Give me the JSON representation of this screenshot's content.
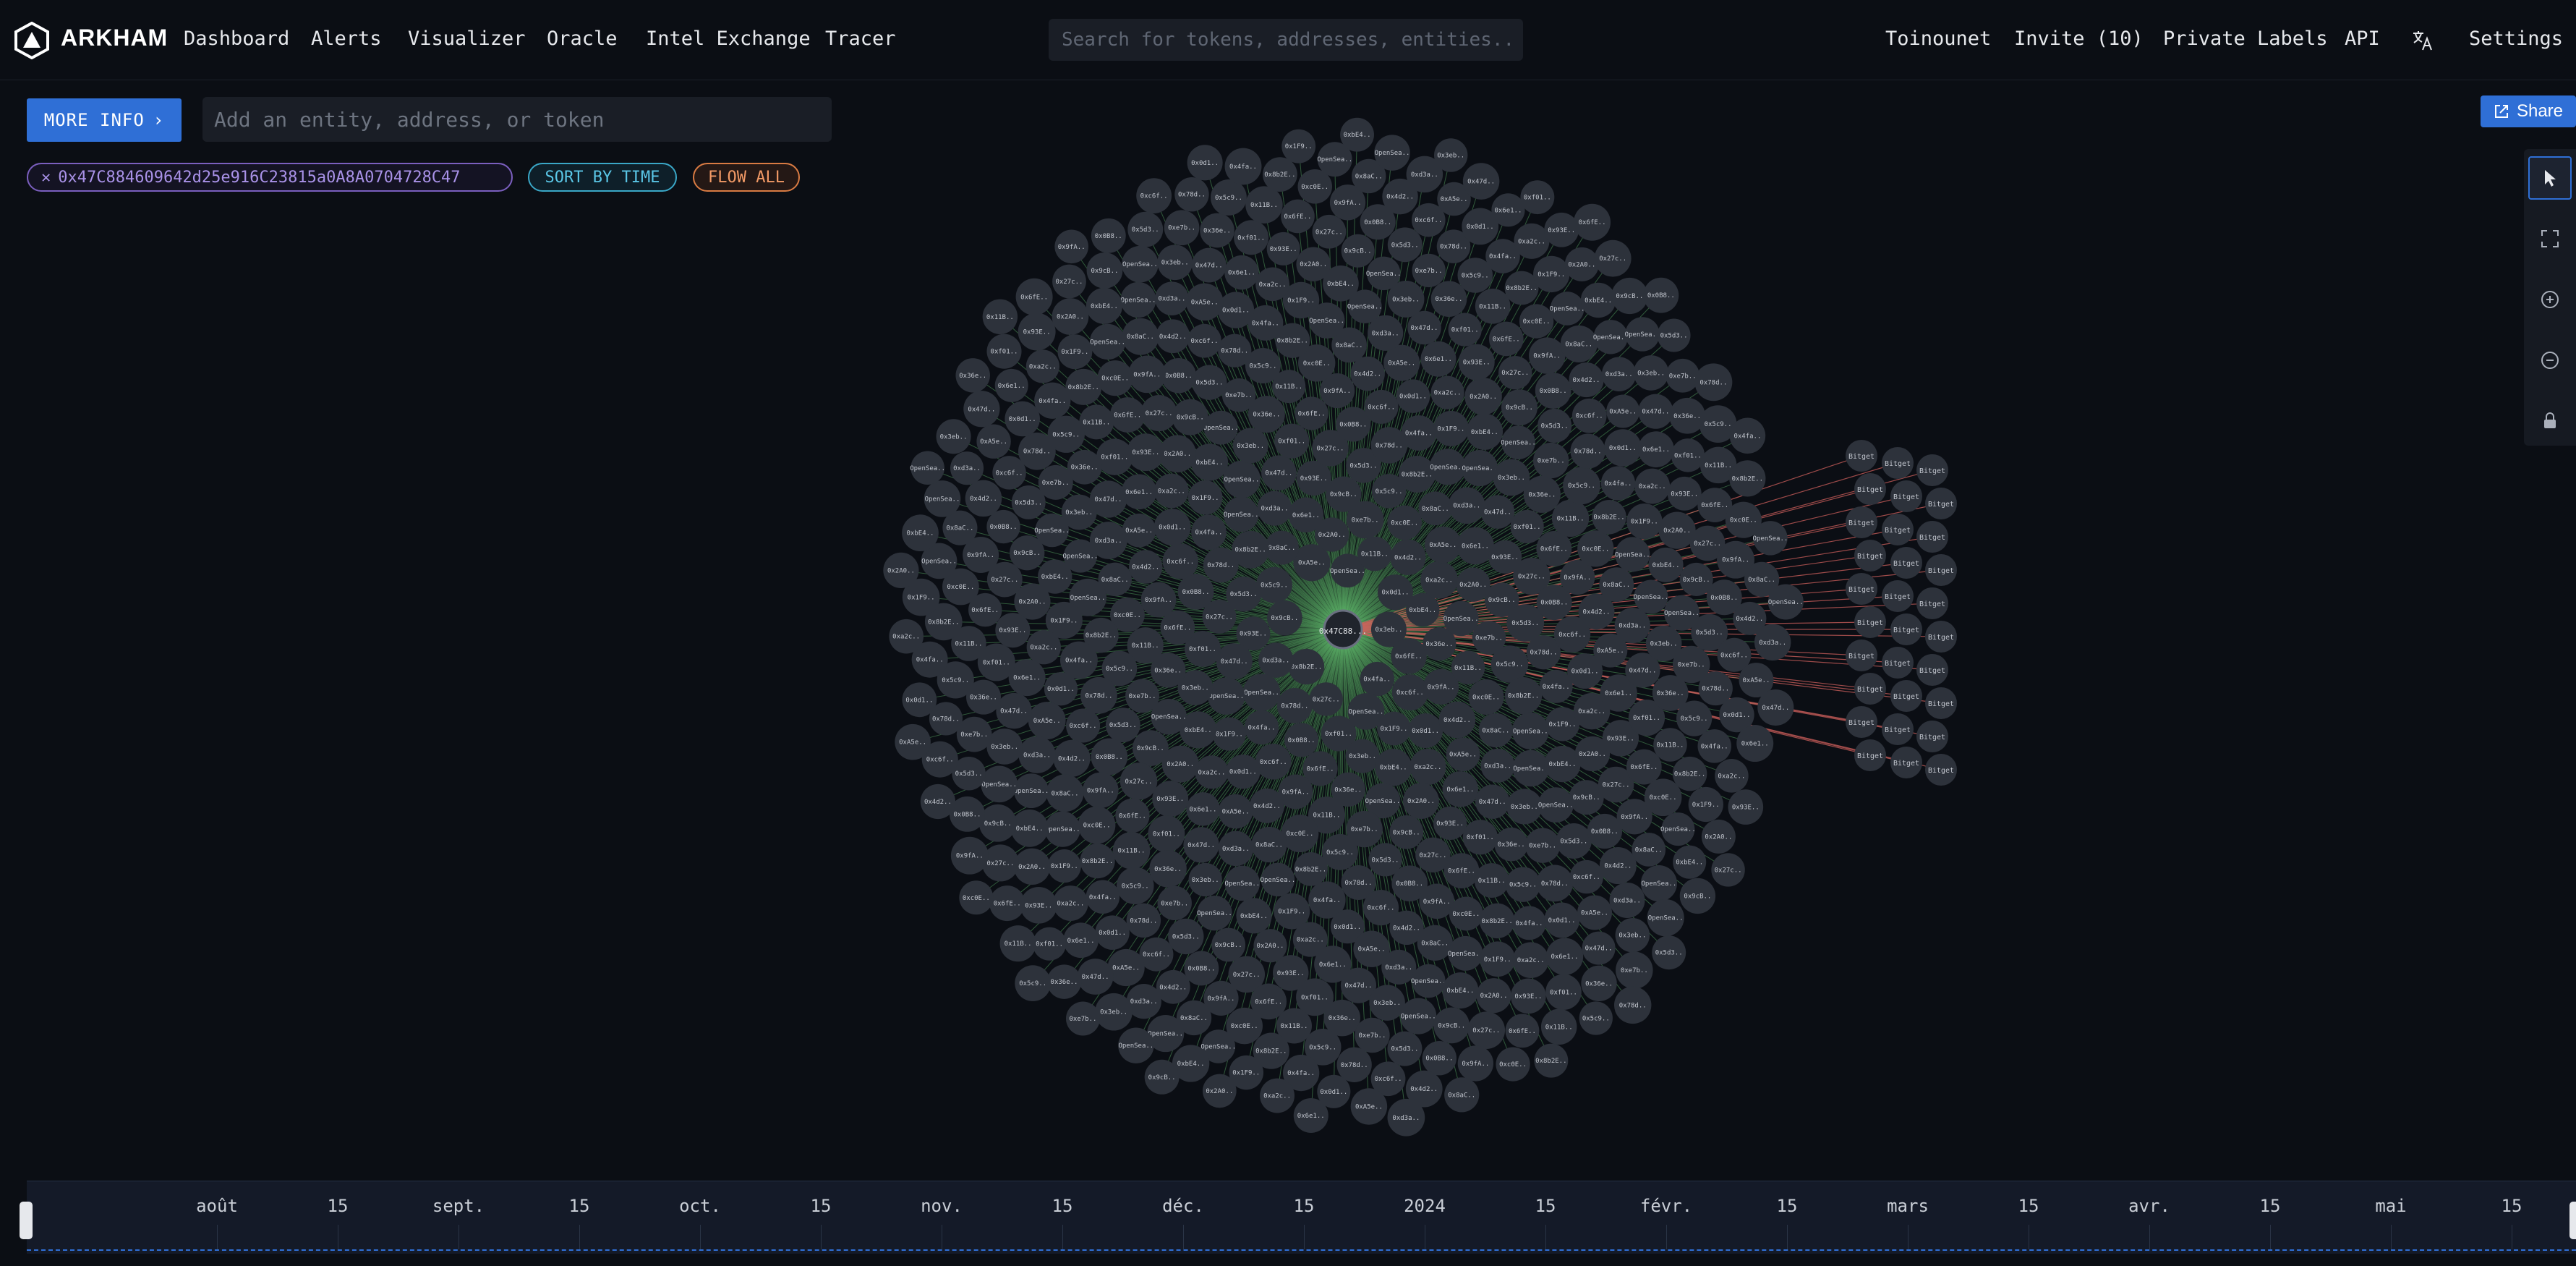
{
  "app": {
    "brand": "ARKHAM"
  },
  "nav": {
    "items": [
      "Dashboard",
      "Alerts",
      "Visualizer",
      "Oracle",
      "Intel Exchange",
      "Tracer"
    ],
    "search_placeholder": "Search for tokens, addresses, entities...",
    "right_items": [
      "Toinounet",
      "Invite (10)",
      "Private Labels",
      "API",
      "Settings"
    ],
    "translate_icon": "translate-icon"
  },
  "toolbar": {
    "more_info_label": "MORE INFO",
    "entity_placeholder": "Add an entity, address, or token",
    "address_chip": "0x47C884609642d25e916C23815a0A8A0704728C47",
    "sort_label": "SORT BY TIME",
    "flow_label": "FLOW ALL",
    "share_label": "Share"
  },
  "tools": [
    "pointer-icon",
    "fit-screen-icon",
    "zoom-in-icon",
    "zoom-out-icon",
    "lock-icon"
  ],
  "graph": {
    "center_label": "0x47C88...",
    "node_labels": [
      "0x3eb..",
      "0x8b2E..",
      "OpenSea..",
      "0x4fa..",
      "0x9cB..",
      "0x0d1..",
      "0x27c..",
      "0xA5e..",
      "0x6fE..",
      "0xd3a..",
      "0x11B..",
      "OpenSea..",
      "0x5c9..",
      "0xbE4..",
      "0x78d..",
      "0x2A0..",
      "0xc6f..",
      "0x93E..",
      "0x4d2..",
      "0xf01..",
      "0x8aC..",
      "0x36e..",
      "OpenSea..",
      "0xe7b..",
      "0x1F9..",
      "0x5d3..",
      "0xa2c..",
      "0x0B8..",
      "0x6e1..",
      "0x9fA..",
      "0x47d..",
      "0xc0E.."
    ],
    "bitget_label": "Bitget"
  },
  "colors": {
    "accent": "#2f6fd6",
    "inflow_edge": "#5fb86a",
    "outflow_edge": "#d0605c",
    "node_fill": "#2d323b",
    "chip_address": "#7b5fbf",
    "chip_sort": "#3aa7c7",
    "chip_flow": "#d97b43"
  },
  "timeline": {
    "ticks": [
      "août",
      "15",
      "sept.",
      "15",
      "oct.",
      "15",
      "nov.",
      "15",
      "déc.",
      "15",
      "2024",
      "15",
      "févr.",
      "15",
      "mars",
      "15",
      "avr.",
      "15",
      "mai",
      "15"
    ]
  }
}
